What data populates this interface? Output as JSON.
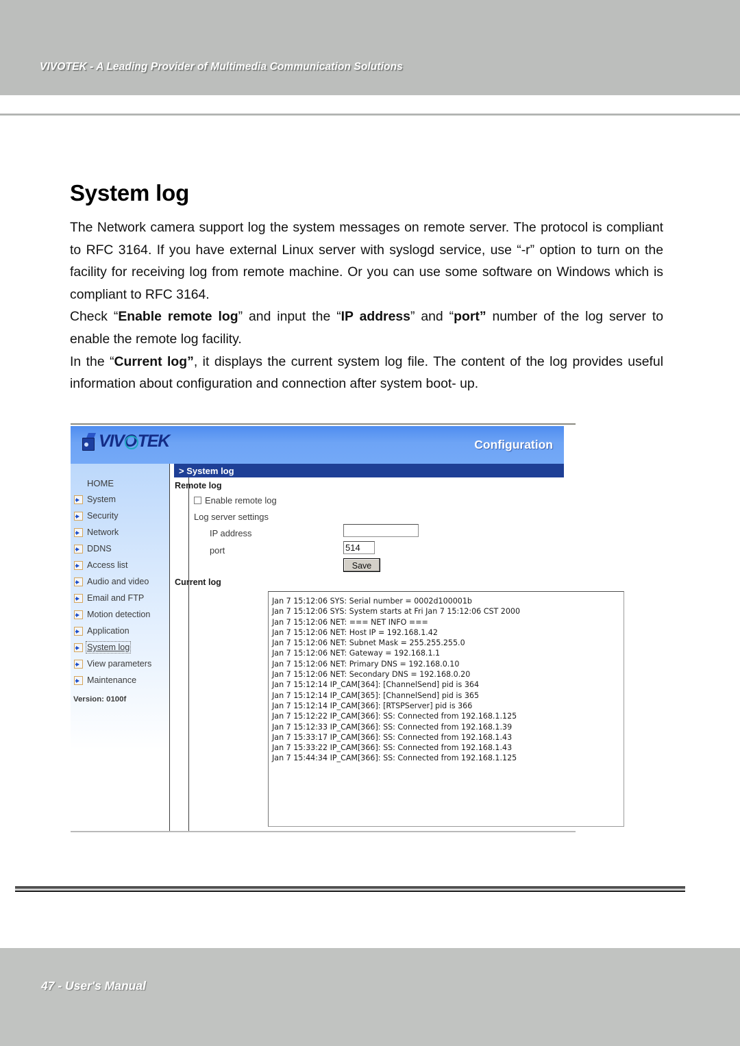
{
  "page": {
    "running_header": "VIVOTEK - A Leading Provider of Multimedia Communication Solutions",
    "title": "System log",
    "footer": "47 - User's Manual"
  },
  "body_copy": {
    "paragraph_1": "The Network camera support log the system messages on remote server. The protocol is compliant to RFC 3164. If you have external Linux server with syslogd service, use “-r” option to turn on the facility for receiving log from remote machine. Or you can use some software on Windows which is compliant to RFC 3164.",
    "paragraph_2_parts": {
      "t1": "Check “",
      "b1": "Enable remote log",
      "t2": "” and input the “",
      "b2": "IP address",
      "t3": "” and “",
      "b3": "port”",
      "t4": " number of the log server to enable the remote log facility."
    },
    "paragraph_3_parts": {
      "t1": "In the “",
      "b1": "Current log”",
      "t2": ", it displays the current system log file. The content of the log provides useful information about configuration and connection after system boot- up."
    }
  },
  "screenshot": {
    "brand": {
      "logo_text_1": "VIV",
      "logo_text_2": "TEK",
      "config_label": "Configuration"
    },
    "sidebar": {
      "items": [
        {
          "label": "HOME",
          "icon": "none",
          "selected": false
        },
        {
          "label": "System",
          "icon": "arrow-icon",
          "selected": false
        },
        {
          "label": "Security",
          "icon": "arrow-icon",
          "selected": false
        },
        {
          "label": "Network",
          "icon": "arrow-icon",
          "selected": false
        },
        {
          "label": "DDNS",
          "icon": "arrow-icon",
          "selected": false
        },
        {
          "label": "Access list",
          "icon": "arrow-icon",
          "selected": false
        },
        {
          "label": "Audio and video",
          "icon": "arrow-icon",
          "selected": false
        },
        {
          "label": "Email and FTP",
          "icon": "arrow-icon",
          "selected": false
        },
        {
          "label": "Motion detection",
          "icon": "arrow-icon",
          "selected": false
        },
        {
          "label": "Application",
          "icon": "arrow-icon",
          "selected": false
        },
        {
          "label": "System log",
          "icon": "arrow-icon",
          "selected": true
        },
        {
          "label": "View parameters",
          "icon": "arrow-icon",
          "selected": false
        },
        {
          "label": "Maintenance",
          "icon": "arrow-icon",
          "selected": false
        }
      ],
      "version": "Version: 0100f"
    },
    "breadcrumb": "> System log",
    "remote_log": {
      "heading": "Remote log",
      "enable_checkbox_label": "Enable remote log",
      "enable_checkbox_checked": false,
      "log_server_settings_label": "Log server settings",
      "ip_address_label": "IP address",
      "ip_address_value": "",
      "ip_address_placeholder": "",
      "port_label": "port",
      "port_value": "514",
      "save_button": "Save"
    },
    "current_log": {
      "heading": "Current log",
      "lines": "Jan 7 15:12:06 SYS: Serial number = 0002d100001b\nJan 7 15:12:06 SYS: System starts at Fri Jan 7 15:12:06 CST 2000\nJan 7 15:12:06 NET: === NET INFO ===\nJan 7 15:12:06 NET: Host IP = 192.168.1.42\nJan 7 15:12:06 NET: Subnet Mask = 255.255.255.0\nJan 7 15:12:06 NET: Gateway = 192.168.1.1\nJan 7 15:12:06 NET: Primary DNS = 192.168.0.10\nJan 7 15:12:06 NET: Secondary DNS = 192.168.0.20\nJan 7 15:12:14 IP_CAM[364]: [ChannelSend] pid is 364\nJan 7 15:12:14 IP_CAM[365]: [ChannelSend] pid is 365\nJan 7 15:12:14 IP_CAM[366]: [RTSPServer] pid is 366\nJan 7 15:12:22 IP_CAM[366]: SS: Connected from 192.168.1.125\nJan 7 15:12:33 IP_CAM[366]: SS: Connected from 192.168.1.39\nJan 7 15:33:17 IP_CAM[366]: SS: Connected from 192.168.1.43\nJan 7 15:33:22 IP_CAM[366]: SS: Connected from 192.168.1.43\nJan 7 15:44:34 IP_CAM[366]: SS: Connected from 192.168.1.125"
    }
  },
  "colors": {
    "band_grey": "#bcbebc",
    "brand_blue": "#6ea4f5",
    "breadcrumb_blue": "#1e3f96",
    "logo_navy": "#132c86",
    "logo_teal": "#1fa8bf"
  }
}
